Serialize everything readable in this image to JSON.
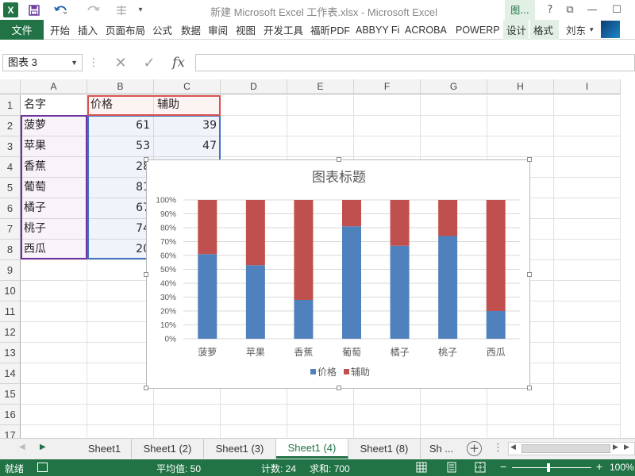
{
  "titlebar": {
    "app_icon": "X",
    "title": "新建 Microsoft Excel 工作表.xlsx - Microsoft Excel",
    "chart_tools_tab": "图...",
    "help": "?",
    "restore": "⧉",
    "minimize": "—",
    "maximize": "☐"
  },
  "ribbon": {
    "file_tab": "文件",
    "tabs": [
      "开始",
      "插入",
      "页面布局",
      "公式",
      "数据",
      "审阅",
      "视图",
      "开发工具",
      "福昕PDF",
      "ABBYY Fi",
      "ACROBA",
      "POWERP"
    ],
    "context_tabs": [
      "设计",
      "格式"
    ],
    "user": "刘东"
  },
  "formula_bar": {
    "name_box": "图表 3",
    "cancel_icon": "✕",
    "enter_icon": "✓",
    "fx_icon": "fx",
    "formula": ""
  },
  "grid": {
    "columns": [
      "A",
      "B",
      "C",
      "D",
      "E",
      "F",
      "G",
      "H",
      "I"
    ],
    "rows": [
      "1",
      "2",
      "3",
      "4",
      "5",
      "6",
      "7",
      "8",
      "9",
      "10",
      "11",
      "12",
      "13",
      "14",
      "15",
      "16",
      "17"
    ],
    "headers": [
      "名字",
      "价格",
      "辅助"
    ],
    "data": [
      [
        "菠萝",
        "61",
        "39"
      ],
      [
        "苹果",
        "53",
        "47"
      ],
      [
        "香蕉",
        "28",
        ""
      ],
      [
        "葡萄",
        "81",
        ""
      ],
      [
        "橘子",
        "67",
        ""
      ],
      [
        "桃子",
        "74",
        ""
      ],
      [
        "西瓜",
        "20",
        ""
      ]
    ]
  },
  "chart_data": {
    "type": "bar",
    "stacked": "percent",
    "title": "图表标题",
    "categories": [
      "菠萝",
      "苹果",
      "香蕉",
      "葡萄",
      "橘子",
      "桃子",
      "西瓜"
    ],
    "series": [
      {
        "name": "价格",
        "values": [
          61,
          53,
          28,
          81,
          67,
          74,
          20
        ],
        "color": "#4f81bd"
      },
      {
        "name": "辅助",
        "values": [
          39,
          47,
          72,
          19,
          33,
          26,
          80
        ],
        "color": "#c0504d"
      }
    ],
    "yticks": [
      "0%",
      "10%",
      "20%",
      "30%",
      "40%",
      "50%",
      "60%",
      "70%",
      "80%",
      "90%",
      "100%"
    ],
    "ylim": [
      0,
      100
    ],
    "grid": true,
    "legend": "bottom"
  },
  "sheet_tabs": {
    "tabs": [
      "Sheet1",
      "Sheet1 (2)",
      "Sheet1 (3)",
      "Sheet1 (4)",
      "Sheet1 (8)",
      "Sh ..."
    ],
    "active": "Sheet1 (4)",
    "add": "+"
  },
  "statusbar": {
    "mode": "就绪",
    "average": "平均值: 50",
    "count": "计数: 24",
    "sum": "求和: 700",
    "zoom": "100%"
  }
}
